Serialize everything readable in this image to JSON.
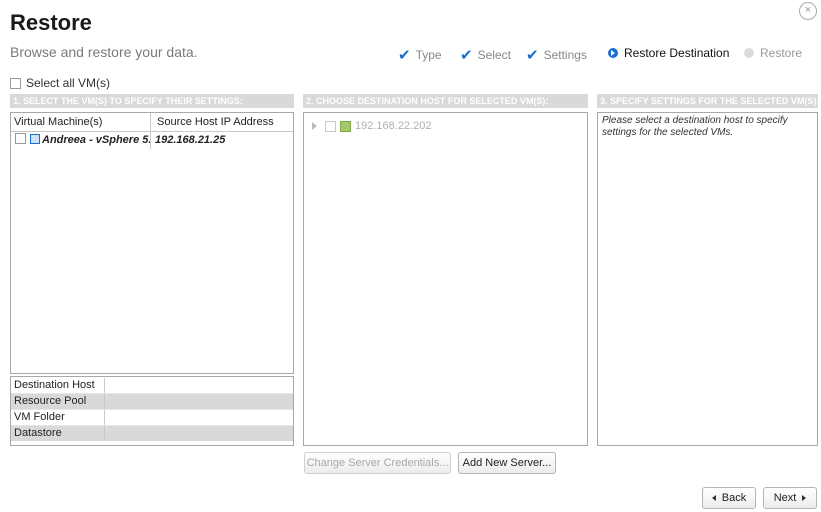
{
  "header": {
    "title": "Restore",
    "subtitle": "Browse and restore your data.",
    "close_glyph": "×"
  },
  "steps": [
    {
      "label": "Type",
      "state": "done",
      "icon": "check-icon"
    },
    {
      "label": "Select",
      "state": "done",
      "icon": "check-icon"
    },
    {
      "label": "Settings",
      "state": "done",
      "icon": "check-icon"
    },
    {
      "label": "Restore Destination",
      "state": "active",
      "icon": "arrow-circle-icon"
    },
    {
      "label": "Restore",
      "state": "future",
      "icon": "circle-icon"
    }
  ],
  "select_all_label": "Select all VM(s)",
  "section1": {
    "header": "1. SELECT THE VM(S) TO SPECIFY THEIR SETTINGS:",
    "columns": [
      "Virtual Machine(s)",
      "Source Host IP Address"
    ],
    "rows": [
      {
        "vm": "Andreea - vSphere 5.",
        "ip": "192.168.21.25"
      }
    ],
    "properties": [
      "Destination Host",
      "Resource Pool",
      "VM Folder",
      "Datastore"
    ]
  },
  "section2": {
    "header": "2. CHOOSE DESTINATION HOST FOR SELECTED VM(S):",
    "host": "192.168.22.202"
  },
  "section3": {
    "header": "3. SPECIFY SETTINGS FOR THE SELECTED VM(S):",
    "hint": "Please select a destination host to specify settings for the selected VMs."
  },
  "buttons": {
    "change_credentials": "Change Server Credentials...",
    "add_server": "Add New Server...",
    "back": "Back",
    "next": "Next"
  },
  "colors": {
    "accent": "#1a6fd0",
    "section_header_bg": "#d9d9d9",
    "host_icon": "#a6c76b"
  }
}
